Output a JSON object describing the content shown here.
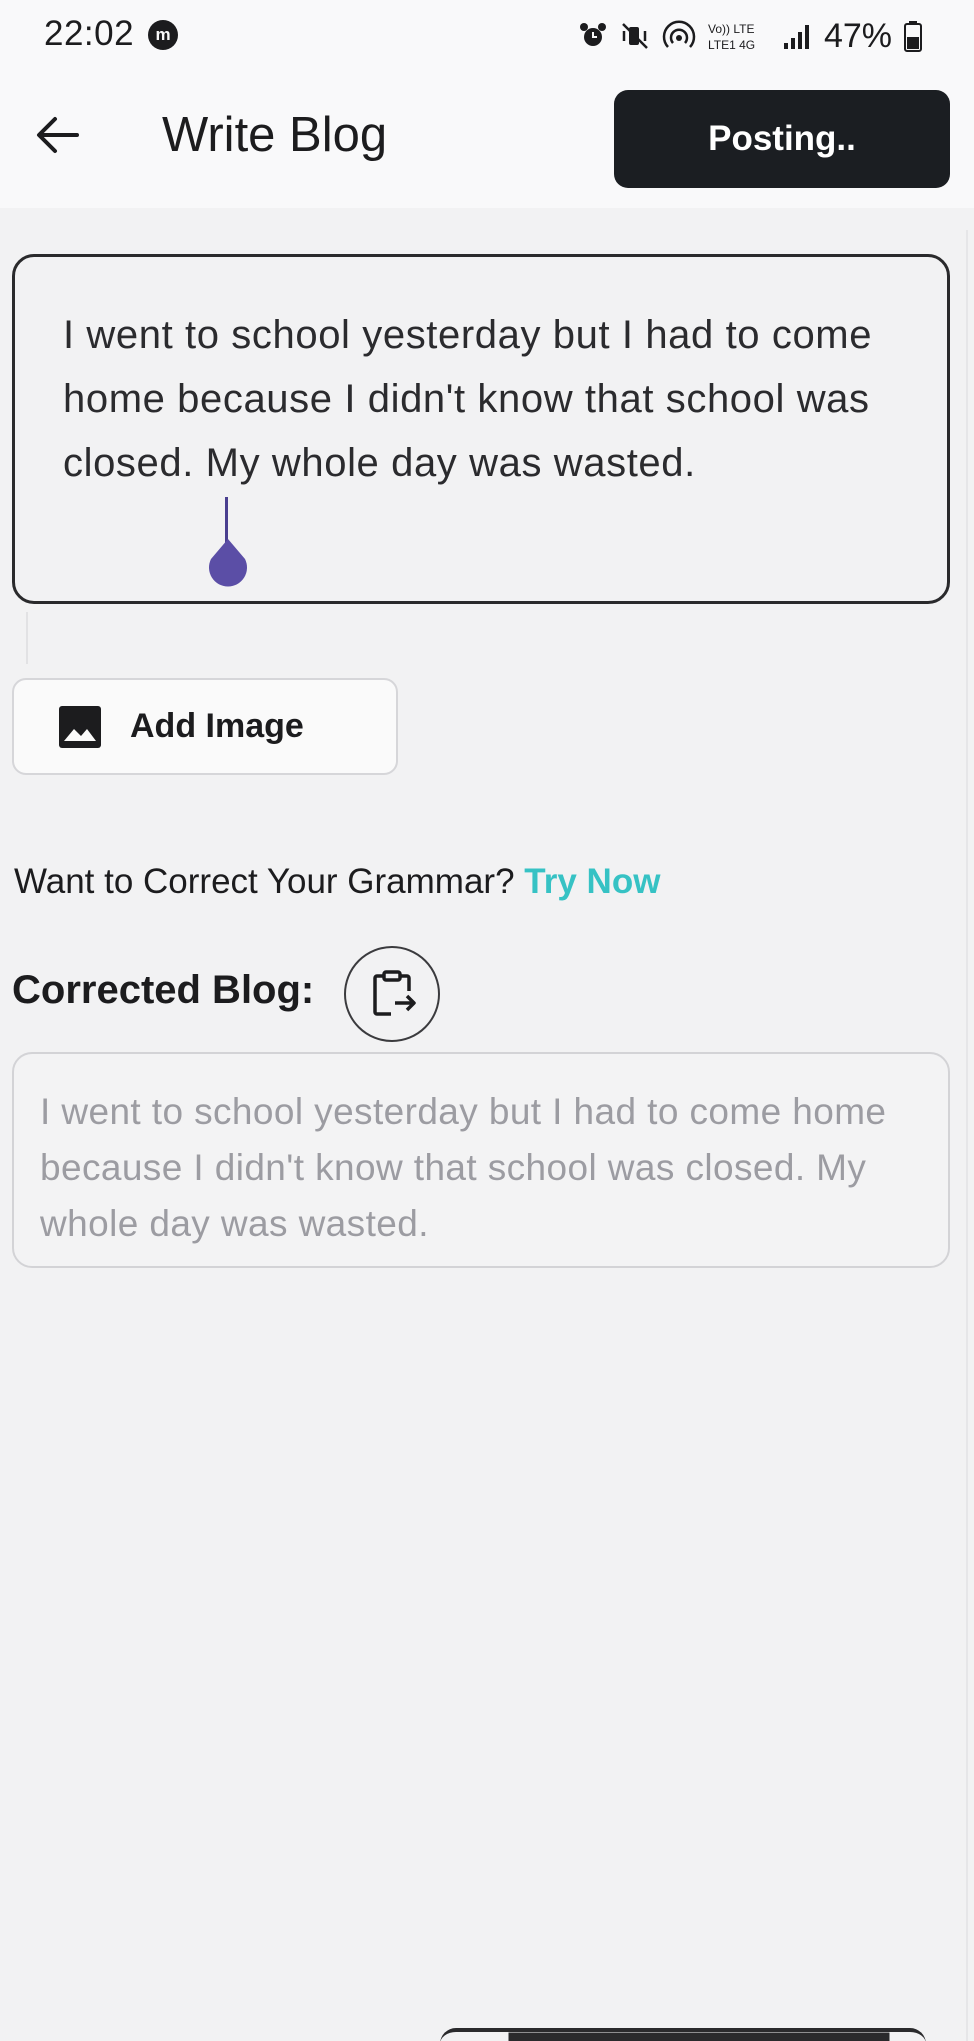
{
  "status_bar": {
    "time": "22:02",
    "app_icon_glyph": "m",
    "battery_percent": "47%",
    "network_label_top": "Vo)) LTE",
    "network_label_bottom": "LTE1 4G"
  },
  "app_bar": {
    "title": "Write Blog",
    "post_button_label": "Posting.."
  },
  "editor": {
    "content": "I went to school yesterday but I had to come home because I didn't know that school was closed. My whole day was wasted.",
    "cursor_color": "#5b4ea6"
  },
  "add_image": {
    "label": "Add Image"
  },
  "grammar": {
    "prompt": "Want to Correct Your Grammar? ",
    "link_label": "Try Now",
    "link_color": "#36c2c4"
  },
  "corrected": {
    "heading": "Corrected Blog:",
    "text": "I went to school yesterday but I had to come home because I didn't know that school was closed. My whole day was wasted."
  },
  "icons": {
    "back": "arrow-left-icon",
    "add_image": "image-icon",
    "copy": "clipboard-paste-icon"
  },
  "colors": {
    "primary_button": "#1b1e22",
    "background": "#f2f2f3",
    "accent_link": "#36c2c4"
  }
}
